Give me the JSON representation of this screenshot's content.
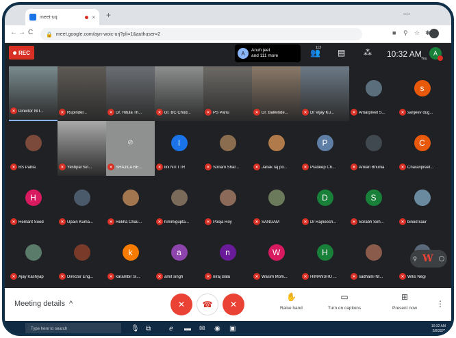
{
  "browser": {
    "tab_title": "meet-uq",
    "tab_close": "×",
    "new_tab": "+",
    "url": "meet.google.com/ayn-woic-urj?pli=1&authuser=2",
    "back": "←",
    "forward": "→",
    "reload": "C",
    "minimize": "—",
    "menu": "⋮"
  },
  "meet_top": {
    "rec_label": "REC",
    "joined_initial": "A",
    "joined_text_line1": "Anuh jeet",
    "joined_text_line2": "and 111 more",
    "participants_count": "112",
    "clock": "10:32 AM",
    "you_label": "You",
    "self_initial": "A"
  },
  "tiles": [
    {
      "name": "Director NIT...",
      "type": "video",
      "color": "#7a8b8f"
    },
    {
      "name": "Rupinder...",
      "type": "video",
      "color": "#5e5a55"
    },
    {
      "name": "Dr. Ritula Th...",
      "type": "video",
      "color": "#6b6f74"
    },
    {
      "name": "Dr. BC Chod...",
      "type": "video",
      "color": "#8d8f8f"
    },
    {
      "name": "PS Panu",
      "type": "video",
      "color": "#6d6a66"
    },
    {
      "name": "Dr. Balwinde...",
      "type": "video",
      "color": "#8b7a68"
    },
    {
      "name": "Dr Vijay Ku...",
      "type": "video",
      "color": "#6c7a86"
    },
    {
      "name": "Amarpreet S...",
      "type": "photo",
      "color": "#5b6e7c"
    },
    {
      "name": "sanjeev dug...",
      "type": "initial",
      "initial": "s",
      "color": "#e8590c"
    },
    {
      "name": "BS Pabla",
      "type": "photo",
      "color": "#7b4a3a"
    },
    {
      "name": "Yeshpal Sin...",
      "type": "video",
      "color": "#a9a9a9"
    },
    {
      "name": "SHAJILA BE...",
      "type": "camoff",
      "color": "#8f9090"
    },
    {
      "name": "lini NITTTR",
      "type": "initial",
      "initial": "l",
      "color": "#1a73e8"
    },
    {
      "name": "Sonam Shar...",
      "type": "photo",
      "color": "#8a6d4f"
    },
    {
      "name": "Janak raj po...",
      "type": "photo",
      "color": "#b07a4a"
    },
    {
      "name": "Pradeep Ch...",
      "type": "initial",
      "initial": "P",
      "color": "#5f7ea6"
    },
    {
      "name": "Ankan Bhunia",
      "type": "photo",
      "color": "#404850"
    },
    {
      "name": "Charanpreet...",
      "type": "initial",
      "initial": "C",
      "color": "#e8590c"
    },
    {
      "name": "Hemant Sood",
      "type": "initial",
      "initial": "H",
      "color": "#d81b60"
    },
    {
      "name": "Upain Kuma...",
      "type": "photo",
      "color": "#4a5a6a"
    },
    {
      "name": "Rekha Chau...",
      "type": "photo",
      "color": "#a2764f"
    },
    {
      "name": "himmigupta...",
      "type": "photo",
      "color": "#7a6a5a"
    },
    {
      "name": "Pooja Roy",
      "type": "photo",
      "color": "#8b6a5a"
    },
    {
      "name": "SANGAM",
      "type": "photo",
      "color": "#6a7a5a"
    },
    {
      "name": "Dr Rajneesh...",
      "type": "initial",
      "initial": "D",
      "color": "#188038"
    },
    {
      "name": "Sorabh Seh...",
      "type": "initial",
      "initial": "S",
      "color": "#188038"
    },
    {
      "name": "binod kaur",
      "type": "photo",
      "color": "#6a8aa0"
    },
    {
      "name": "Ajay Kashyap",
      "type": "photo",
      "color": "#5a7a6a"
    },
    {
      "name": "Director Eng...",
      "type": "photo",
      "color": "#7a3a2a"
    },
    {
      "name": "karambir Si...",
      "type": "initial",
      "initial": "k",
      "color": "#f57c00"
    },
    {
      "name": "amit singh",
      "type": "initial",
      "initial": "a",
      "color": "#8e44ad"
    },
    {
      "name": "niraj Bala",
      "type": "initial",
      "initial": "n",
      "color": "#6a1b9a"
    },
    {
      "name": "Wasim Mohi...",
      "type": "initial",
      "initial": "W",
      "color": "#d81b60"
    },
    {
      "name": "HIMANSHU ...",
      "type": "initial",
      "initial": "H",
      "color": "#188038"
    },
    {
      "name": "sadhami NI...",
      "type": "photo",
      "color": "#8a5a4a"
    },
    {
      "name": "Wilis Negi",
      "type": "photo",
      "color": "#5a6a7a"
    }
  ],
  "self_preview": {
    "pin": "⚲",
    "letter": "W"
  },
  "controls": {
    "meeting_details": "Meeting details",
    "chevron": "^",
    "mic": "✕",
    "hangup": "☎",
    "camera": "✕",
    "raise_hand": "Raise hand",
    "captions": "Turn on captions",
    "present": "Present now",
    "more": "⋮"
  },
  "taskbar": {
    "search": "Type here to search",
    "tray_time": "10:32 AM",
    "tray_date": "2/8/2021"
  }
}
